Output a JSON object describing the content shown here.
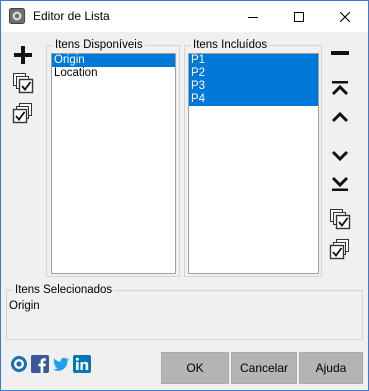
{
  "window": {
    "title": "Editor de Lista"
  },
  "left_toolbar": {
    "icons": [
      "plus-icon",
      "check-all-icon",
      "uncheck-all-icon"
    ]
  },
  "available": {
    "label": "Itens Disponíveis",
    "items": [
      {
        "text": "Origin",
        "selected": true
      },
      {
        "text": "Location",
        "selected": false
      }
    ]
  },
  "included": {
    "label": "Itens Incluídos",
    "items": [
      {
        "text": "P1",
        "selected": true
      },
      {
        "text": "P2",
        "selected": true
      },
      {
        "text": "P3",
        "selected": true
      },
      {
        "text": "P4",
        "selected": true
      }
    ]
  },
  "right_toolbar": {
    "icons": [
      "minus-icon",
      "move-top-icon",
      "move-up-icon",
      "move-down-icon",
      "move-bottom-icon",
      "check-all-icon",
      "uncheck-all-icon"
    ]
  },
  "selected_items": {
    "label": "Itens Selecionados",
    "value": "Origin"
  },
  "buttons": {
    "ok": "OK",
    "cancel": "Cancelar",
    "help": "Ajuda"
  },
  "social": [
    "ring-logo-icon",
    "facebook-icon",
    "twitter-icon",
    "linkedin-icon"
  ],
  "colors": {
    "selection": "#0078d7",
    "button_bg": "#b4b4b4",
    "window_border": "#3a7bd5"
  }
}
